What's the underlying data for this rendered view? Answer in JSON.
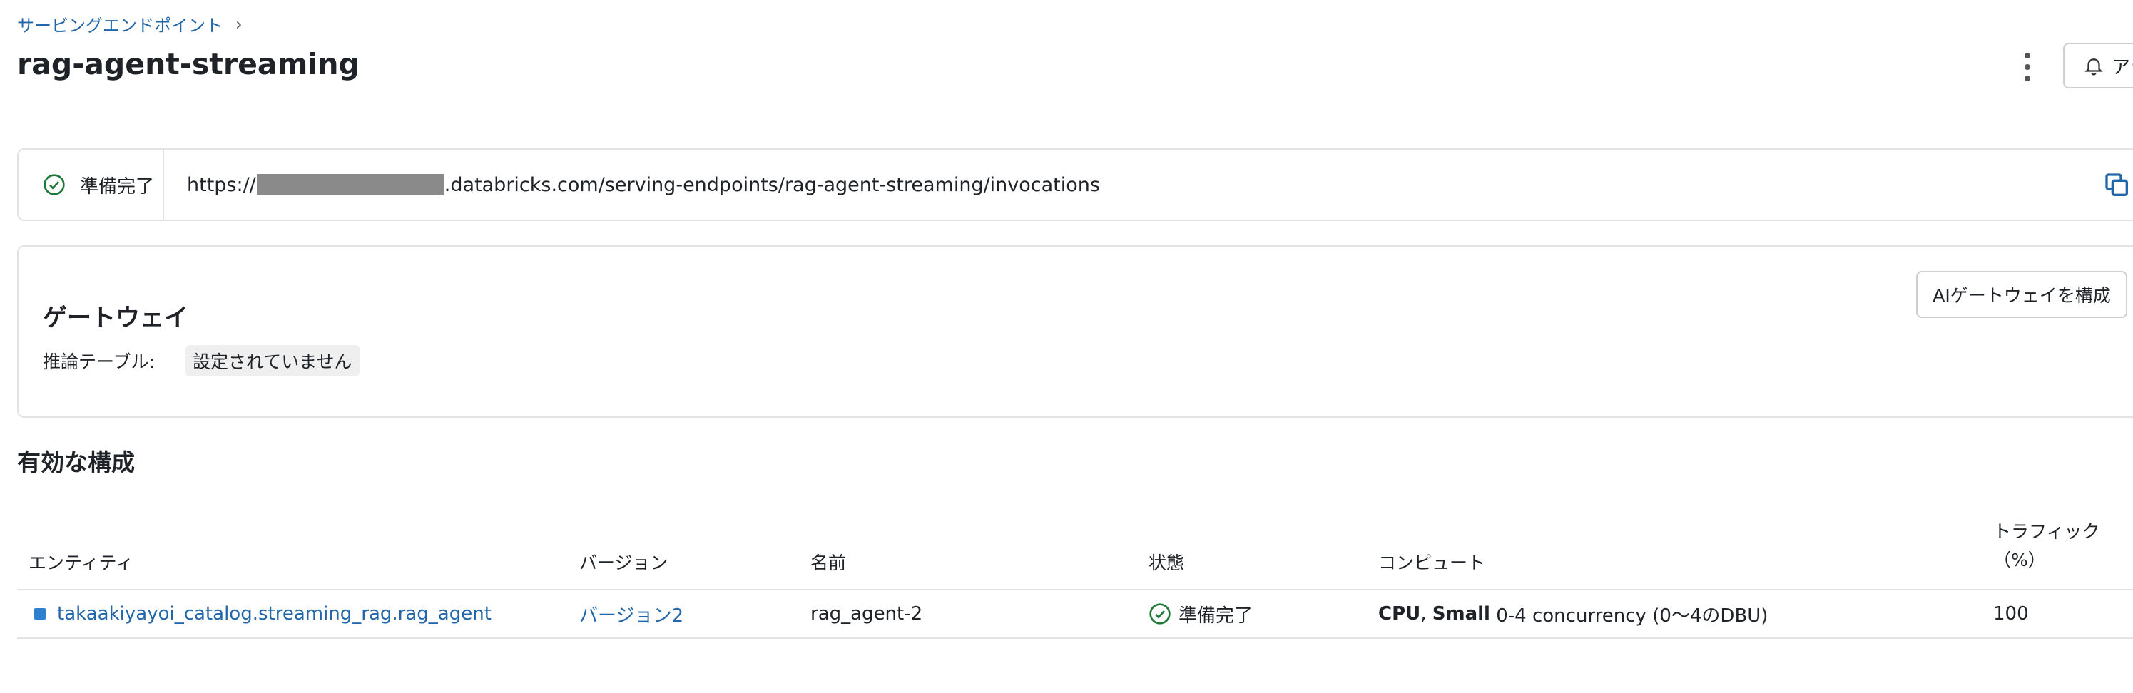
{
  "breadcrumb": {
    "label": "サービングエンドポイント",
    "chevron": "›"
  },
  "page": {
    "title": "rag-agent-streaming"
  },
  "header": {
    "alert_label": "アラ"
  },
  "endpoint": {
    "status": "準備完了",
    "url_prefix": "https://",
    "url_suffix": ".databricks.com/serving-endpoints/rag-agent-streaming/invocations",
    "status_color": "#1f7a3a"
  },
  "gateway": {
    "title": "ゲートウェイ",
    "inference_table_label": "推論テーブル:",
    "inference_table_value": "設定されていません",
    "configure_button": "AIゲートウェイを構成"
  },
  "active_config": {
    "title": "有効な構成",
    "columns": {
      "entity": "エンティティ",
      "version": "バージョン",
      "name": "名前",
      "state": "状態",
      "compute": "コンピュート",
      "traffic_line1": "トラフィック",
      "traffic_line2": "（%）"
    },
    "rows": [
      {
        "entity": "takaakiyayoi_catalog.streaming_rag.rag_agent",
        "version": "バージョン2",
        "name": "rag_agent-2",
        "state": "準備完了",
        "compute_cpu": "CPU",
        "compute_sep": ", ",
        "compute_size": "Small",
        "compute_detail": " 0-4 concurrency (0〜4のDBU)",
        "traffic": "100"
      }
    ]
  },
  "colors": {
    "link": "#2266aa",
    "success": "#1f7a3a",
    "border": "#e3e3e3"
  }
}
